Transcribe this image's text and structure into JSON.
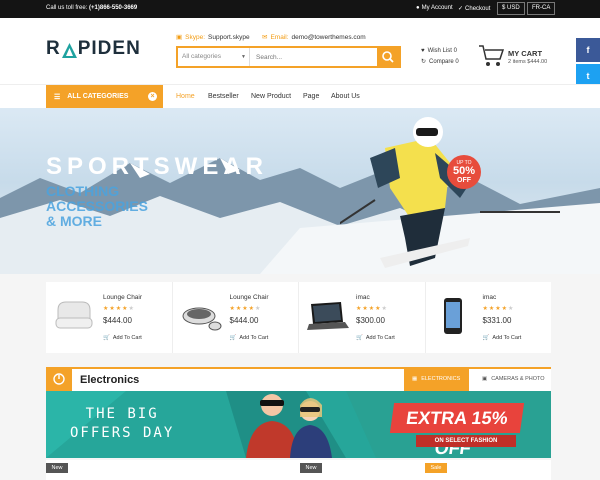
{
  "topbar": {
    "call_label": "Call us toll free:",
    "phone": "(+1)866-550-3669",
    "my_account": "My Account",
    "checkout": "Checkout",
    "currency": "$ USD",
    "language": "FR-CA"
  },
  "header": {
    "logo_prefix": "R",
    "logo_suffix": "PIDEN",
    "skype_label": "Skype:",
    "skype_value": "Support.skype",
    "email_label": "Email:",
    "email_value": "demo@towerthemes.com",
    "search_category": "All categories",
    "search_placeholder": "Search...",
    "wishlist": "Wish List 0",
    "compare": "Compare 0",
    "cart_title": "MY CART",
    "cart_sub": "2 items $444.00"
  },
  "nav": {
    "all_categories": "ALL CATEGORIES",
    "items": [
      "Home",
      "Bestseller",
      "New Product",
      "Page",
      "About Us"
    ],
    "active": "Home"
  },
  "hero": {
    "title": "SPORTSWEAR",
    "sub_lines": [
      "CLOTHING",
      "ACCESSORIES",
      "& MORE"
    ],
    "badge_top": "UP TO",
    "badge_pct": "50%",
    "badge_off": "OFF"
  },
  "products": [
    {
      "name": "Lounge Chair",
      "price": "$444.00",
      "rating": 4,
      "add": "Add To Cart"
    },
    {
      "name": "Lounge Chair",
      "price": "$444.00",
      "rating": 4,
      "add": "Add To Cart"
    },
    {
      "name": "imac",
      "price": "$300.00",
      "rating": 4,
      "add": "Add To Cart"
    },
    {
      "name": "imac",
      "price": "$331.00",
      "rating": 4,
      "add": "Add To Cart"
    }
  ],
  "section": {
    "title": "Electronics",
    "tab_active": "ELECTRONICS",
    "tab_other": "CAMERAS & PHOTO"
  },
  "banner": {
    "line1": "THE BIG",
    "line2": "OFFERS DAY",
    "extra": "EXTRA 15% OFF",
    "select": "ON SELECT FASHION"
  },
  "tags": [
    "New",
    "New",
    "Sale"
  ],
  "colors": {
    "accent": "#f4a228",
    "dark": "#141414",
    "teal": "#26a69a",
    "red": "#e74c3c"
  },
  "social": [
    "facebook-icon",
    "twitter-icon",
    "rss-icon",
    "youtube-icon",
    "google-plus-icon",
    "pinterest-icon"
  ]
}
